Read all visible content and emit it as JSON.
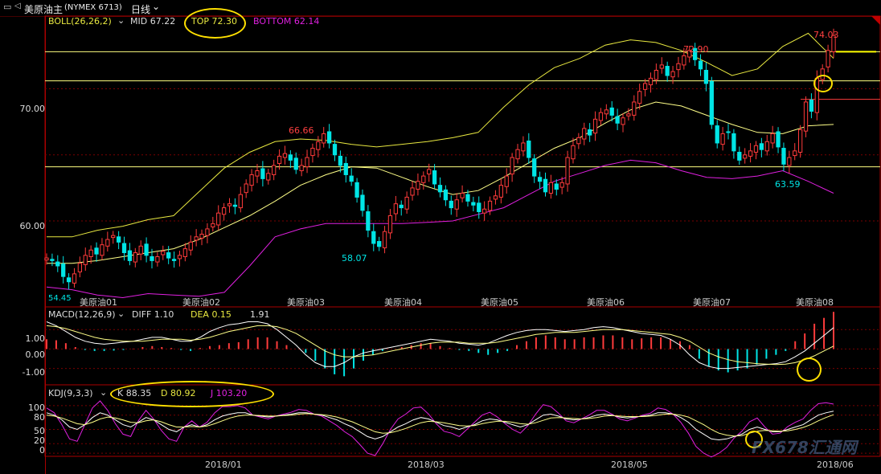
{
  "window": {
    "symbol": "美原油主",
    "code": "(NYMEX 6713)",
    "period": "日线"
  },
  "colors": {
    "up": "#ff3b3b",
    "down": "#00e5e5",
    "boll_mid": "#ffff88",
    "boll_top": "#e8e840",
    "boll_bottom": "#e020e0",
    "grid": "#7a0000",
    "highlight": "#ffe000"
  },
  "price_panel": {
    "indicator": "BOLL(26,26,2)",
    "mid_label": "MID 67.22",
    "top_label": "TOP 72.30",
    "bottom_label": "BOTTOM 62.14",
    "y_ticks": [
      "70.00",
      "60.00"
    ],
    "annotations": [
      "66.66",
      "58.07",
      "72.90",
      "63.59",
      "74.03",
      "54.45"
    ],
    "contract_labels": [
      "美原油01",
      "美原油02",
      "美原油03",
      "美原油04",
      "美原油05",
      "美原油06",
      "美原油07",
      "美原油08"
    ]
  },
  "macd_panel": {
    "indicator": "MACD(12,26,9)",
    "diff_label": "DIFF 1.10",
    "dea_label": "DEA 0.15",
    "macd_value": "1.91",
    "y_ticks": [
      "1.00",
      "0.00",
      "-1.00"
    ]
  },
  "kdj_panel": {
    "indicator": "KDJ(9,3,3)",
    "k_label": "K 88.35",
    "d_label": "D 80.92",
    "j_label": "J 103.20",
    "y_ticks": [
      "100",
      "80",
      "50",
      "20",
      "0"
    ]
  },
  "x_axis": {
    "dates": [
      "2018/01",
      "2018/03",
      "2018/05",
      "2018/06"
    ]
  },
  "watermark": {
    "text": "FX678汇通网"
  },
  "chart_data": {
    "type": "candlestick",
    "price_range": [
      53.5,
      75.5
    ],
    "close_series": [
      57.2,
      57.0,
      56.6,
      55.8,
      55.4,
      56.0,
      56.8,
      57.4,
      57.8,
      57.5,
      58.2,
      58.6,
      58.9,
      58.4,
      57.6,
      57.0,
      57.6,
      58.1,
      57.4,
      57.0,
      57.3,
      57.7,
      57.2,
      57.0,
      57.4,
      57.9,
      58.4,
      58.8,
      59.0,
      59.4,
      59.8,
      60.6,
      61.0,
      61.3,
      61.1,
      62.0,
      62.8,
      63.5,
      63.8,
      63.2,
      63.6,
      64.2,
      64.9,
      65.1,
      64.6,
      63.9,
      64.2,
      64.8,
      65.5,
      66.0,
      66.6,
      65.9,
      65.0,
      64.2,
      63.5,
      63.0,
      61.8,
      60.8,
      59.3,
      58.3,
      58.07,
      59.2,
      60.4,
      61.3,
      61.0,
      61.8,
      62.5,
      63.0,
      63.4,
      63.9,
      62.8,
      62.2,
      61.6,
      61.0,
      61.6,
      62.1,
      61.5,
      61.2,
      60.7,
      60.9,
      61.5,
      61.9,
      62.7,
      63.4,
      64.8,
      65.4,
      65.9,
      64.8,
      63.4,
      63.0,
      62.2,
      62.9,
      62.4,
      62.9,
      64.8,
      65.7,
      66.3,
      67.0,
      66.5,
      67.7,
      68.2,
      68.4,
      68.0,
      67.4,
      67.8,
      68.1,
      69.0,
      69.8,
      70.4,
      70.8,
      71.4,
      71.8,
      71.0,
      71.3,
      71.9,
      72.5,
      72.9,
      72.2,
      71.5,
      70.4,
      67.3,
      65.9,
      66.6,
      66.7,
      65.3,
      64.6,
      65.0,
      65.3,
      65.7,
      65.4,
      66.0,
      66.6,
      65.6,
      64.3,
      64.8,
      65.3,
      66.9,
      69.0,
      68.3,
      70.8,
      71.5,
      72.9,
      74.03
    ],
    "boll_top_series": [
      58.8,
      58.8,
      59.3,
      59.6,
      60.1,
      60.4,
      62.2,
      64.0,
      65.2,
      66.0,
      66.2,
      66.1,
      65.8,
      65.6,
      65.8,
      66.0,
      66.3,
      66.7,
      68.6,
      70.3,
      71.6,
      72.3,
      73.3,
      73.7,
      73.5,
      72.9,
      72.0,
      71.0,
      71.5,
      73.2,
      74.2,
      72.3
    ],
    "boll_mid_series": [
      56.8,
      56.8,
      57.0,
      57.3,
      57.6,
      57.9,
      58.6,
      59.5,
      60.4,
      61.5,
      62.7,
      63.5,
      64.1,
      64.0,
      63.3,
      62.6,
      62.0,
      62.3,
      63.3,
      64.4,
      65.5,
      66.3,
      67.4,
      68.4,
      69.0,
      68.7,
      68.0,
      67.3,
      66.7,
      66.6,
      67.2,
      67.3
    ],
    "boll_bottom_series": [
      55.0,
      54.8,
      54.4,
      54.2,
      54.5,
      54.4,
      54.3,
      54.6,
      56.6,
      58.8,
      59.4,
      59.8,
      59.8,
      59.8,
      59.8,
      59.9,
      60.0,
      60.5,
      61.0,
      62.0,
      63.0,
      63.6,
      64.2,
      64.6,
      64.4,
      63.8,
      63.3,
      63.2,
      63.4,
      63.8,
      63.0,
      62.1
    ],
    "macd_range": [
      -1.8,
      2.0
    ],
    "macd_hist": [
      0.5,
      0.45,
      0.3,
      0.1,
      -0.05,
      -0.1,
      -0.1,
      -0.08,
      -0.05,
      0.02,
      0.1,
      0.15,
      0.1,
      0.05,
      -0.05,
      -0.1,
      0.05,
      0.15,
      0.2,
      0.3,
      0.35,
      0.5,
      0.6,
      0.6,
      0.4,
      0.2,
      0.0,
      -0.2,
      -0.6,
      -1.0,
      -1.3,
      -1.4,
      -1.0,
      -0.6,
      -0.3,
      -0.1,
      0.0,
      0.1,
      0.2,
      0.3,
      0.3,
      0.15,
      0.05,
      -0.05,
      -0.1,
      -0.2,
      -0.3,
      -0.2,
      -0.1,
      0.2,
      0.4,
      0.6,
      0.7,
      0.6,
      0.5,
      0.5,
      0.6,
      0.6,
      0.7,
      0.7,
      0.6,
      0.5,
      0.55,
      0.6,
      0.6,
      0.5,
      0.4,
      0.2,
      -0.5,
      -0.9,
      -1.1,
      -1.2,
      -1.1,
      -1.0,
      -0.8,
      -0.5,
      -0.3,
      -0.1,
      0.4,
      0.8,
      1.3,
      1.6,
      1.91
    ],
    "macd_diff": [
      1.4,
      1.2,
      0.9,
      0.6,
      0.4,
      0.3,
      0.25,
      0.3,
      0.35,
      0.4,
      0.5,
      0.6,
      0.6,
      0.5,
      0.4,
      0.4,
      0.6,
      0.9,
      1.1,
      1.25,
      1.3,
      1.4,
      1.4,
      1.3,
      1.0,
      0.6,
      0.2,
      -0.3,
      -0.7,
      -0.9,
      -0.9,
      -0.7,
      -0.4,
      -0.2,
      -0.1,
      0.0,
      0.1,
      0.2,
      0.3,
      0.4,
      0.5,
      0.45,
      0.4,
      0.3,
      0.25,
      0.2,
      0.3,
      0.5,
      0.7,
      0.85,
      0.95,
      1.0,
      1.0,
      0.95,
      0.9,
      0.95,
      1.0,
      1.1,
      1.15,
      1.1,
      1.0,
      0.9,
      0.8,
      0.75,
      0.7,
      0.5,
      0.2,
      -0.3,
      -0.7,
      -0.9,
      -1.0,
      -1.0,
      -0.95,
      -0.9,
      -0.85,
      -0.8,
      -0.75,
      -0.65,
      -0.4,
      -0.1,
      0.3,
      0.7,
      1.1
    ],
    "macd_dea": [
      1.2,
      1.15,
      1.05,
      0.9,
      0.75,
      0.6,
      0.5,
      0.45,
      0.4,
      0.4,
      0.4,
      0.45,
      0.5,
      0.5,
      0.5,
      0.45,
      0.5,
      0.6,
      0.75,
      0.9,
      1.0,
      1.1,
      1.2,
      1.2,
      1.15,
      1.0,
      0.8,
      0.5,
      0.2,
      -0.1,
      -0.3,
      -0.4,
      -0.4,
      -0.35,
      -0.3,
      -0.2,
      -0.1,
      0.0,
      0.1,
      0.2,
      0.3,
      0.35,
      0.35,
      0.35,
      0.3,
      0.3,
      0.3,
      0.35,
      0.45,
      0.55,
      0.65,
      0.75,
      0.8,
      0.85,
      0.85,
      0.85,
      0.9,
      0.95,
      1.0,
      1.0,
      1.0,
      0.95,
      0.9,
      0.85,
      0.8,
      0.75,
      0.6,
      0.4,
      0.1,
      -0.2,
      -0.4,
      -0.55,
      -0.65,
      -0.7,
      -0.75,
      -0.78,
      -0.8,
      -0.78,
      -0.7,
      -0.55,
      -0.35,
      -0.1,
      0.15
    ],
    "kdj_range": [
      -10,
      115
    ],
    "kdj_k": [
      85,
      80,
      70,
      55,
      50,
      60,
      75,
      85,
      80,
      70,
      60,
      55,
      65,
      75,
      70,
      60,
      50,
      45,
      55,
      60,
      55,
      60,
      70,
      78,
      82,
      85,
      85,
      80,
      78,
      76,
      78,
      80,
      82,
      85,
      85,
      82,
      80,
      75,
      70,
      62,
      55,
      45,
      35,
      30,
      35,
      45,
      55,
      62,
      70,
      75,
      72,
      65,
      58,
      55,
      50,
      55,
      60,
      68,
      72,
      70,
      65,
      60,
      55,
      60,
      70,
      80,
      82,
      78,
      72,
      70,
      72,
      75,
      80,
      82,
      80,
      76,
      74,
      76,
      78,
      80,
      85,
      85,
      82,
      75,
      65,
      50,
      40,
      30,
      28,
      30,
      35,
      40,
      50,
      55,
      50,
      45,
      45,
      50,
      55,
      60,
      70,
      80,
      85,
      88.35
    ],
    "kdj_d": [
      80,
      78,
      74,
      68,
      62,
      60,
      65,
      72,
      76,
      74,
      70,
      65,
      64,
      68,
      70,
      66,
      60,
      55,
      55,
      56,
      55,
      57,
      62,
      68,
      74,
      78,
      80,
      80,
      79,
      78,
      78,
      79,
      80,
      82,
      83,
      82,
      81,
      79,
      76,
      71,
      66,
      59,
      52,
      45,
      42,
      43,
      47,
      52,
      58,
      64,
      67,
      66,
      64,
      61,
      58,
      57,
      58,
      62,
      65,
      67,
      67,
      65,
      62,
      61,
      64,
      69,
      74,
      75,
      74,
      73,
      72,
      73,
      75,
      78,
      79,
      78,
      77,
      77,
      77,
      78,
      80,
      82,
      82,
      80,
      76,
      68,
      60,
      50,
      42,
      38,
      36,
      37,
      42,
      46,
      48,
      47,
      46,
      47,
      50,
      54,
      60,
      68,
      75,
      80.92
    ],
    "kdj_j": [
      95,
      85,
      60,
      30,
      25,
      60,
      95,
      110,
      90,
      62,
      40,
      35,
      68,
      90,
      72,
      48,
      30,
      25,
      55,
      68,
      55,
      65,
      85,
      98,
      98,
      100,
      95,
      80,
      76,
      72,
      78,
      82,
      86,
      92,
      90,
      82,
      78,
      68,
      58,
      45,
      35,
      18,
      0,
      -5,
      20,
      50,
      72,
      82,
      95,
      97,
      82,
      62,
      46,
      42,
      35,
      50,
      65,
      80,
      86,
      76,
      62,
      50,
      42,
      58,
      82,
      102,
      98,
      84,
      68,
      64,
      72,
      80,
      90,
      90,
      82,
      72,
      68,
      74,
      80,
      84,
      95,
      92,
      82,
      65,
      42,
      14,
      0,
      -8,
      0,
      12,
      32,
      46,
      66,
      74,
      55,
      40,
      42,
      56,
      65,
      72,
      90,
      104,
      106,
      103.2
    ]
  }
}
